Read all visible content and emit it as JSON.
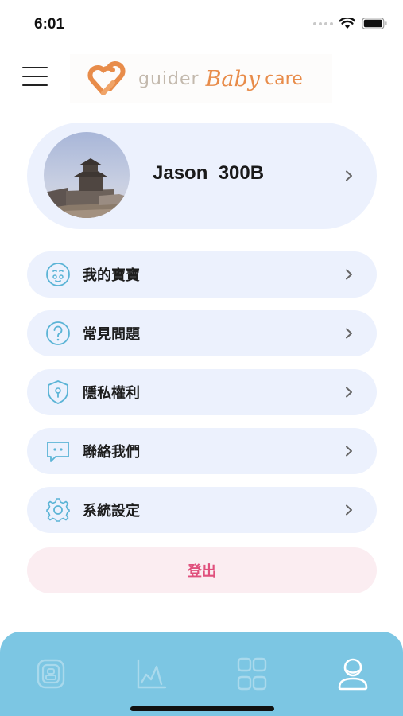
{
  "status": {
    "time": "6:01"
  },
  "header": {
    "logo": {
      "guider": "guider",
      "baby": "Baby",
      "care": "care"
    }
  },
  "profile": {
    "name": "Jason_300B"
  },
  "menu": [
    {
      "label": "我的寶寶",
      "icon": "baby-face-icon"
    },
    {
      "label": "常見問題",
      "icon": "question-icon"
    },
    {
      "label": "隱私權利",
      "icon": "shield-lock-icon"
    },
    {
      "label": "聯絡我們",
      "icon": "chat-bubble-icon"
    },
    {
      "label": "系統設定",
      "icon": "gear-icon"
    }
  ],
  "logout": {
    "label": "登出"
  },
  "tabbar": {
    "tabs": [
      {
        "icon": "device-icon",
        "active": false
      },
      {
        "icon": "chart-icon",
        "active": false
      },
      {
        "icon": "grid-icon",
        "active": false
      },
      {
        "icon": "profile-icon",
        "active": true
      }
    ]
  },
  "colors": {
    "card_bg": "#ecf1fd",
    "accent_blue": "#7cc6e3",
    "icon_blue": "#5bb4d6",
    "logout_bg": "#fbedf1",
    "logout_text": "#e0507d",
    "logo_orange": "#e88c4a"
  }
}
